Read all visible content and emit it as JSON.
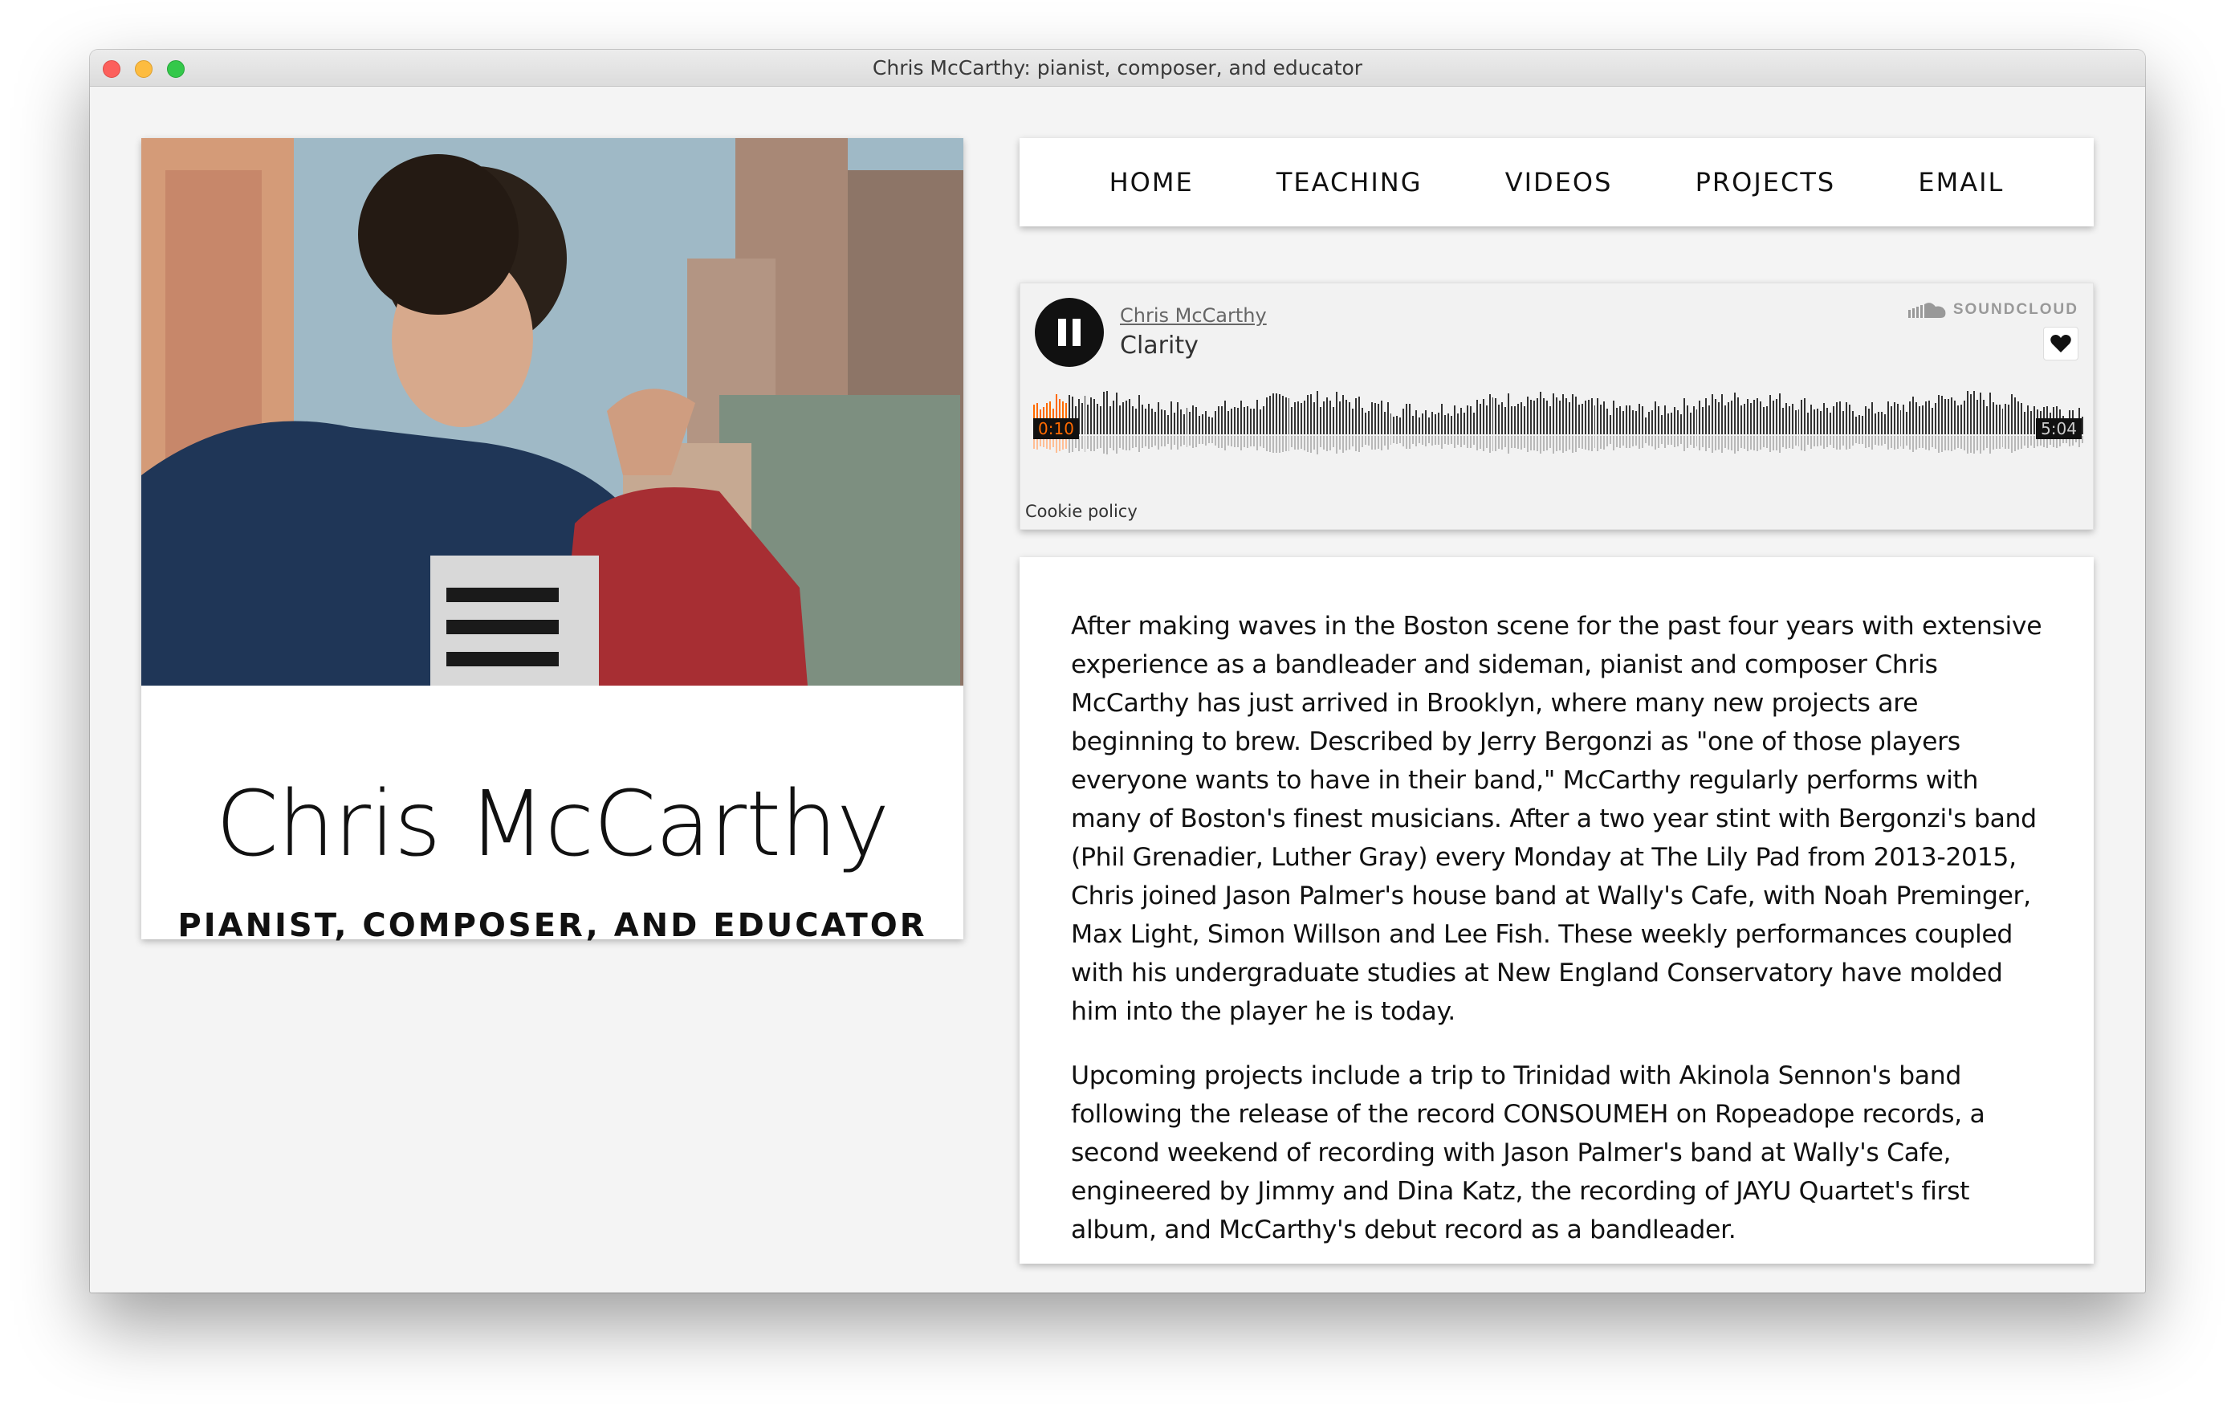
{
  "window": {
    "title": "Chris McCarthy: pianist, composer, and educator"
  },
  "profile": {
    "name": "Chris McCarthy",
    "tagline": "PIANIST, COMPOSER, AND EDUCATOR"
  },
  "nav": {
    "items": [
      {
        "label": "HOME"
      },
      {
        "label": "TEACHING"
      },
      {
        "label": "VIDEOS"
      },
      {
        "label": "PROJECTS"
      },
      {
        "label": "EMAIL"
      }
    ]
  },
  "player": {
    "artist": "Chris McCarthy",
    "track": "Clarity",
    "brand": "SOUNDCLOUD",
    "elapsed": "0:10",
    "duration": "5:04",
    "progress": 0.033,
    "state": "playing",
    "cookie_policy": "Cookie policy",
    "accent_color": "#ff6a00"
  },
  "bio": {
    "paragraphs": [
      "After making waves in the Boston scene for the past four years with extensive experience as a bandleader and sideman, pianist and composer Chris McCarthy has just arrived in Brooklyn, where many new projects are beginning to brew. Described by Jerry Bergonzi as \"one of those players everyone wants to have in their band,\" McCarthy regularly performs with many of Boston's finest musicians. After a two year stint with Bergonzi's band (Phil Grenadier, Luther Gray) every Monday at The Lily Pad from 2013-2015, Chris joined Jason Palmer's house band at Wally's Cafe, with Noah Preminger, Max Light, Simon Willson and Lee Fish. These weekly performances coupled with his undergraduate studies at New England Conservatory have molded him into the player he is today.",
      "Upcoming projects include a trip to Trinidad with Akinola Sennon's band following the release of the record CONSOUMEH on Ropeadope records, a second weekend of recording with Jason Palmer's band at Wally's Cafe, engineered by Jimmy and Dina Katz, the recording of JAYU Quartet's first album, and McCarthy's debut record as a bandleader."
    ]
  }
}
